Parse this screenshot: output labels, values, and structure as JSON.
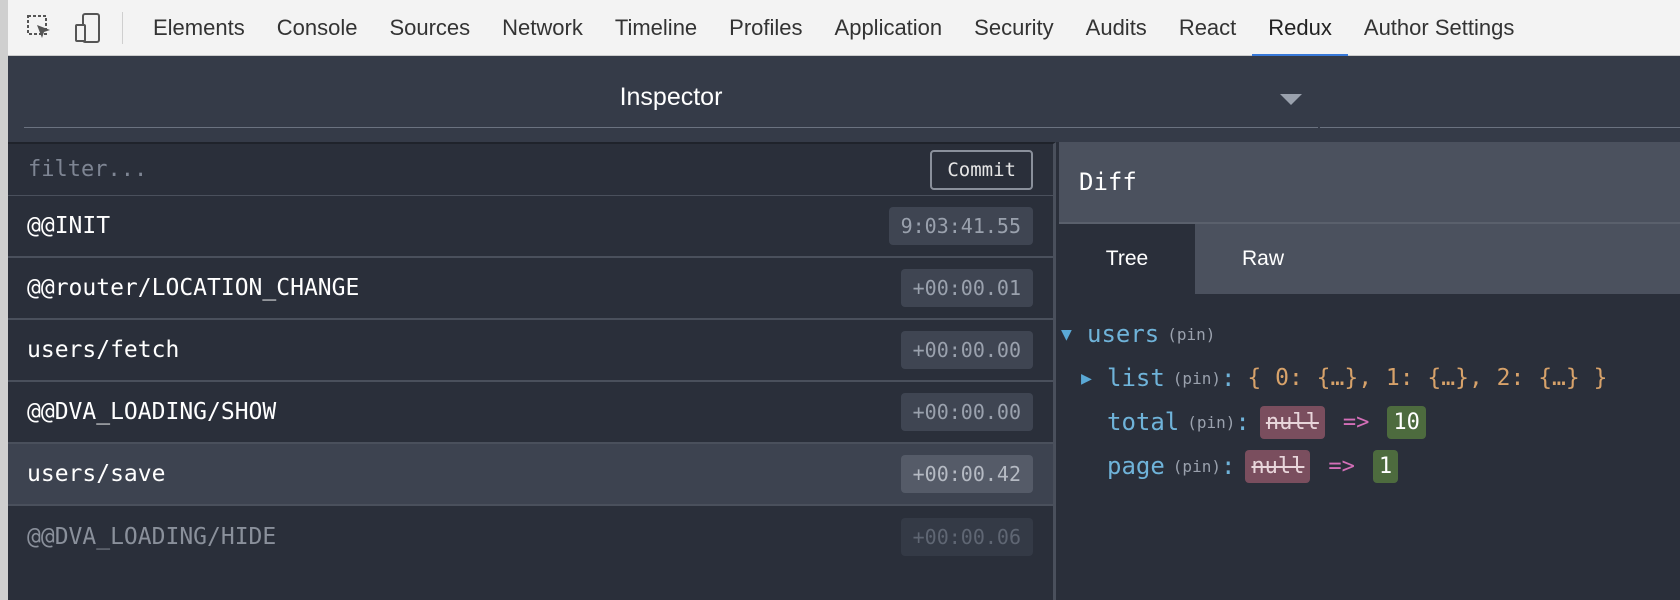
{
  "devtools": {
    "tools": [
      {
        "icon": "inspect-element-icon"
      },
      {
        "icon": "device-mode-icon"
      }
    ],
    "tabs": [
      "Elements",
      "Console",
      "Sources",
      "Network",
      "Timeline",
      "Profiles",
      "Application",
      "Security",
      "Audits",
      "React",
      "Redux",
      "Author Settings"
    ],
    "active_tab": "Redux"
  },
  "redux": {
    "monitor": "Inspector",
    "filter_placeholder": "filter...",
    "commit_label": "Commit",
    "actions": [
      {
        "name": "@@INIT",
        "time": "9:03:41.55",
        "state": "normal"
      },
      {
        "name": "@@router/LOCATION_CHANGE",
        "time": "+00:00.01",
        "state": "normal"
      },
      {
        "name": "users/fetch",
        "time": "+00:00.00",
        "state": "normal"
      },
      {
        "name": "@@DVA_LOADING/SHOW",
        "time": "+00:00.00",
        "state": "normal"
      },
      {
        "name": "users/save",
        "time": "+00:00.42",
        "state": "selected"
      },
      {
        "name": "@@DVA_LOADING/HIDE",
        "time": "+00:00.06",
        "state": "skipped"
      }
    ],
    "diff": {
      "title": "Diff",
      "tabs": [
        "Tree",
        "Raw"
      ],
      "active_tab": "Tree",
      "tree": {
        "root_key": "users",
        "pin": "(pin)",
        "list_key": "list",
        "list_preview": "{ 0: {…}, 1: {…}, 2: {…} }",
        "total_key": "total",
        "total_old": "null",
        "total_new": "10",
        "page_key": "page",
        "page_old": "null",
        "page_new": "1",
        "arrow": "=>"
      }
    }
  },
  "colors": {
    "tab_active_underline": "#3879d9",
    "panel_bg": "#2a2f3a",
    "removed_bg": "#7a4e5e",
    "added_bg": "#4d6b3e",
    "key": "#6fb3d9"
  }
}
